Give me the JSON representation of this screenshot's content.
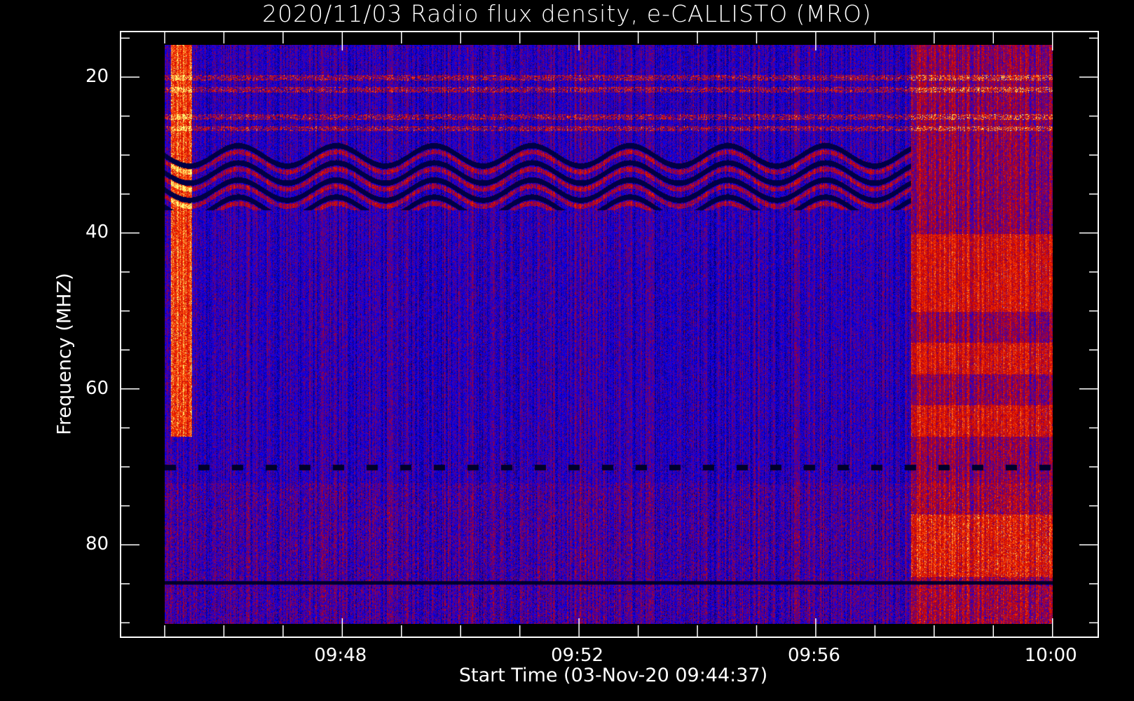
{
  "chart_data": {
    "type": "heatmap",
    "title": "2020/11/03  Radio flux density, e-CALLISTO (MRO)",
    "xlabel": "Start Time (03-Nov-20 09:44:37)",
    "ylabel": "Frequency (MHZ)",
    "x_range_minutes": [
      "09:45",
      "10:00"
    ],
    "x_ticks": [
      "09:48",
      "09:52",
      "09:56",
      "10:00"
    ],
    "x_tick_minutes": [
      3,
      7,
      11,
      15
    ],
    "ylim": [
      15.8,
      90.1
    ],
    "y_ticks": [
      "20",
      "40",
      "60",
      "80"
    ],
    "y_tick_values": [
      20,
      40,
      60,
      80
    ],
    "y_inverted": true,
    "colormap": [
      "#000000",
      "#0000ff",
      "#ff0000",
      "#ffff00"
    ],
    "features": {
      "burst_start_min": 0.1,
      "burst_end_min": 0.45,
      "enhanced_region_start_min": 12.6,
      "bright_lines_mhz": [
        20,
        21.5,
        25,
        26.5
      ],
      "dark_line_mhz": 70,
      "wavy_band_mhz": [
        28,
        37
      ]
    }
  }
}
